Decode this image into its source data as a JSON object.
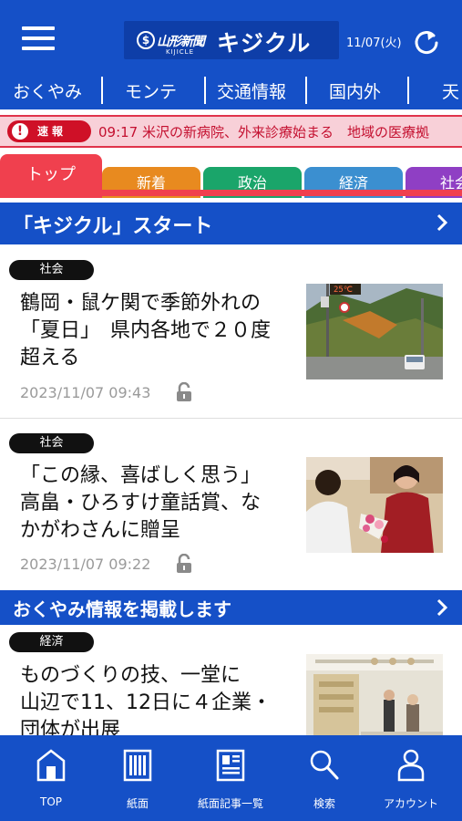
{
  "header": {
    "logo_paper": "山形新聞",
    "logo_title": "キジクル",
    "logo_sub": "KIJICLE",
    "date": "11/07(火)"
  },
  "nav": {
    "items": [
      "おくやみ",
      "モンテ",
      "交通情報",
      "国内外",
      "天"
    ]
  },
  "breaking": {
    "badge": "速報",
    "text": "09:17  米沢の新病院、外来診療始まる　地域の医療拠"
  },
  "tabs": [
    {
      "label": "トップ",
      "color": "#f0404e"
    },
    {
      "label": "新着",
      "color": "#e88a1f"
    },
    {
      "label": "政治",
      "color": "#1aa56a"
    },
    {
      "label": "経済",
      "color": "#3b8fd0"
    },
    {
      "label": "社会",
      "color": "#8f3fc4"
    }
  ],
  "sections": {
    "kijicle_start": "「キジクル」スタート",
    "okuyami": "おくやみ情報を掲載します"
  },
  "articles": [
    {
      "category": "社会",
      "headline": [
        "鶴岡・鼠ケ関で季節外れの",
        "「夏日」　県内各地で２０度",
        "超える"
      ],
      "datetime": "2023/11/07 09:43",
      "image_sign": "25℃"
    },
    {
      "category": "社会",
      "headline": [
        "「この縁、喜ばしく思う」",
        "高畠・ひろすけ童話賞、な",
        "かがわさんに贈呈"
      ],
      "datetime": "2023/11/07 09:22"
    },
    {
      "category": "経済",
      "headline": [
        "ものづくりの技、一堂に",
        "山辺で11、12日に４企業・",
        "団体が出展"
      ]
    }
  ],
  "bottom_nav": [
    {
      "label": "TOP",
      "icon": "home-icon"
    },
    {
      "label": "紙面",
      "icon": "newspaper-icon"
    },
    {
      "label": "紙面記事一覧",
      "icon": "article-list-icon"
    },
    {
      "label": "検索",
      "icon": "search-icon"
    },
    {
      "label": "アカウント",
      "icon": "account-icon"
    }
  ],
  "colors": {
    "brand_blue": "#1550c7",
    "breaking_red": "#cf1027",
    "breaking_bg": "#f8d0d8"
  }
}
